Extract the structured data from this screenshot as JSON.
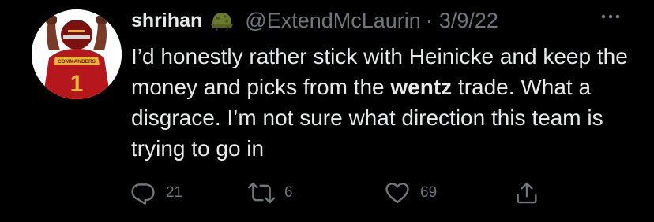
{
  "tweet": {
    "author": {
      "display_name": "shrihan",
      "emoji_icon": "military-helmet-icon",
      "handle": "@ExtendMcLaurin",
      "separator": "·",
      "date": "3/9/22",
      "avatar_jersey_text": "COMMANDERS",
      "avatar_jersey_number": "1"
    },
    "more_icon": "ellipsis-icon",
    "text": {
      "part1": "I’d honestly rather stick with Heinicke and keep the money and picks from the ",
      "bold": "wentz",
      "part2": " trade. What a disgrace. I’m not sure what direction this team is trying to go in"
    },
    "actions": {
      "reply": {
        "icon": "reply-icon",
        "count": "21"
      },
      "retweet": {
        "icon": "retweet-icon",
        "count": "6"
      },
      "like": {
        "icon": "heart-icon",
        "count": "69"
      },
      "share": {
        "icon": "share-icon"
      }
    },
    "colors": {
      "background": "#000000",
      "primary_text": "#e7e9ea",
      "secondary_text": "#71767b",
      "jersey_red": "#b5171c",
      "jersey_gold": "#e8b43b"
    }
  }
}
